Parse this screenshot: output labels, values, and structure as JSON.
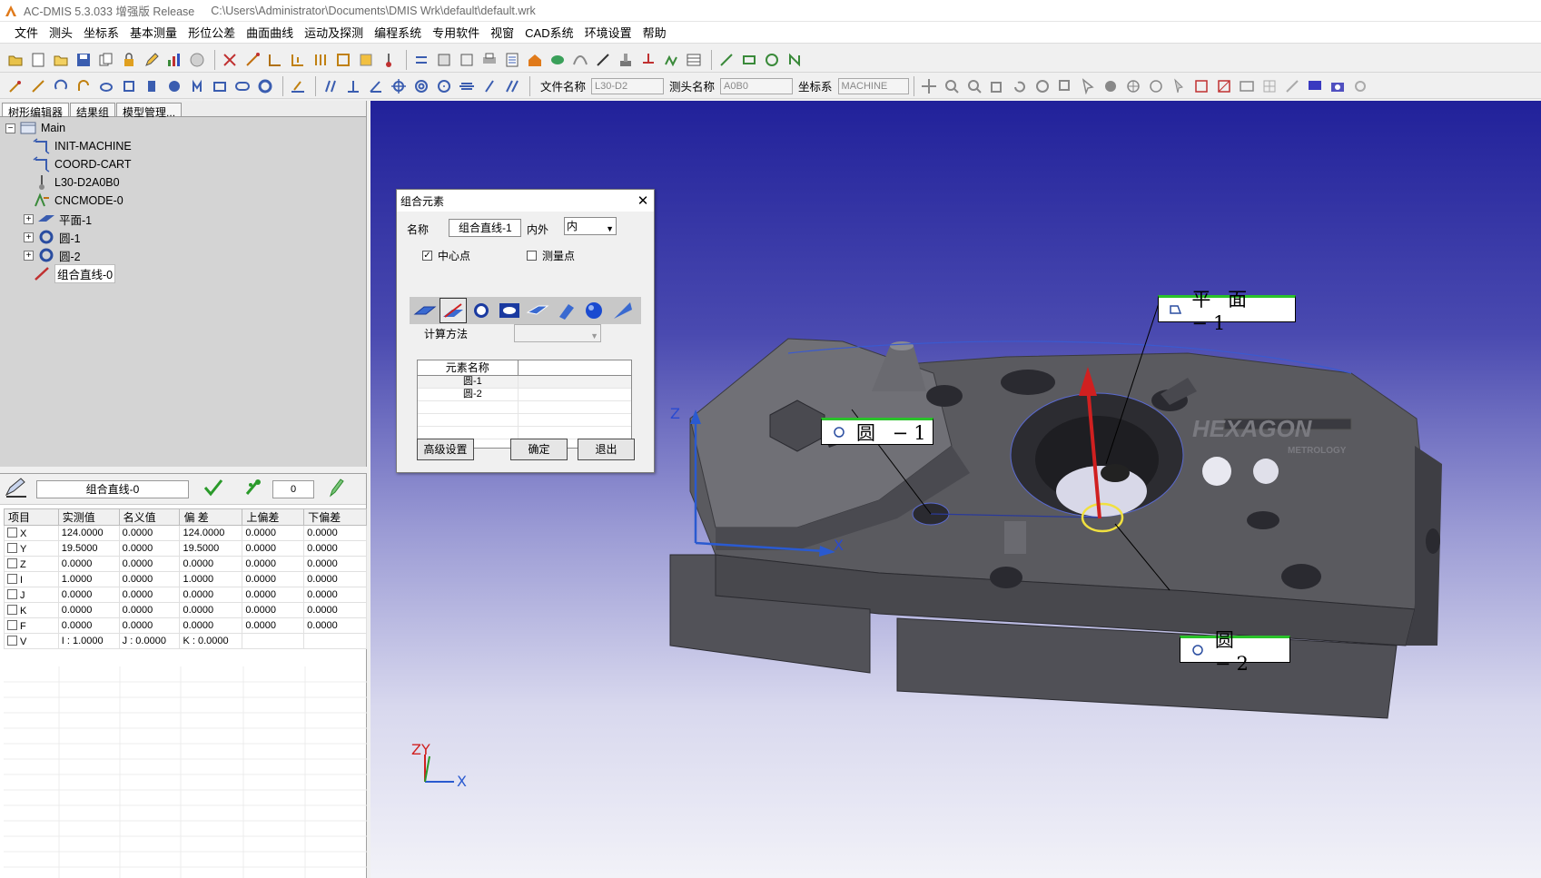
{
  "window": {
    "title": "AC-DMIS 5.3.033 增强版 Release",
    "path": "C:\\Users\\Administrator\\Documents\\DMIS Wrk\\default\\default.wrk"
  },
  "menu": [
    "文件",
    "测头",
    "坐标系",
    "基本测量",
    "形位公差",
    "曲面曲线",
    "运动及探测",
    "编程系统",
    "专用软件",
    "视窗",
    "CAD系统",
    "环境设置",
    "帮助"
  ],
  "toolbar2": {
    "file_label": "文件名称",
    "file_value": "L30-D2",
    "probe_label": "测头名称",
    "probe_value": "A0B0",
    "coord_label": "坐标系",
    "coord_value": "MACHINE"
  },
  "tabs": [
    "树形编辑器",
    "结果组",
    "模型管理..."
  ],
  "tree": {
    "root": "Main",
    "items": [
      "INIT-MACHINE",
      "COORD-CART",
      "L30-D2A0B0",
      "CNCMODE-0",
      "平面-1",
      "圆-1",
      "圆-2",
      "组合直线-0"
    ]
  },
  "results": {
    "feature_name": "组合直线-0",
    "count": "0",
    "columns": [
      "项目",
      "实测值",
      "名义值",
      "偏 差",
      "上偏差",
      "下偏差"
    ],
    "rows": [
      [
        "X",
        "124.0000",
        "0.0000",
        "124.0000",
        "0.0000",
        "0.0000"
      ],
      [
        "Y",
        "19.5000",
        "0.0000",
        "19.5000",
        "0.0000",
        "0.0000"
      ],
      [
        "Z",
        "0.0000",
        "0.0000",
        "0.0000",
        "0.0000",
        "0.0000"
      ],
      [
        "I",
        "1.0000",
        "0.0000",
        "1.0000",
        "0.0000",
        "0.0000"
      ],
      [
        "J",
        "0.0000",
        "0.0000",
        "0.0000",
        "0.0000",
        "0.0000"
      ],
      [
        "K",
        "0.0000",
        "0.0000",
        "0.0000",
        "0.0000",
        "0.0000"
      ],
      [
        "F",
        "0.0000",
        "0.0000",
        "0.0000",
        "0.0000",
        "0.0000"
      ]
    ],
    "v_row": {
      "item": "V",
      "i": "I : 1.0000",
      "j": "J : 0.0000",
      "k": "K : 0.0000"
    }
  },
  "dialog": {
    "title": "组合元素",
    "name_label": "名称",
    "name_value": "组合直线-1",
    "inout_label": "内外",
    "inout_value": "内",
    "center_label": "中心点",
    "measure_label": "测量点",
    "calc_label": "计算方法",
    "elem_header": "元素名称",
    "elements": [
      "圆-1",
      "圆-2"
    ],
    "btn_advanced": "高级设置",
    "btn_ok": "确定",
    "btn_exit": "退出"
  },
  "viewport": {
    "tag_plane": "平 面 −1",
    "tag_circle1": "圆 −1",
    "tag_circle2": "圆 −2",
    "brand": "HEXAGON",
    "brand_sub": "METROLOGY",
    "axis_z": "Z",
    "axis_x": "X",
    "triad_zy": "ZY",
    "triad_x": "X"
  }
}
